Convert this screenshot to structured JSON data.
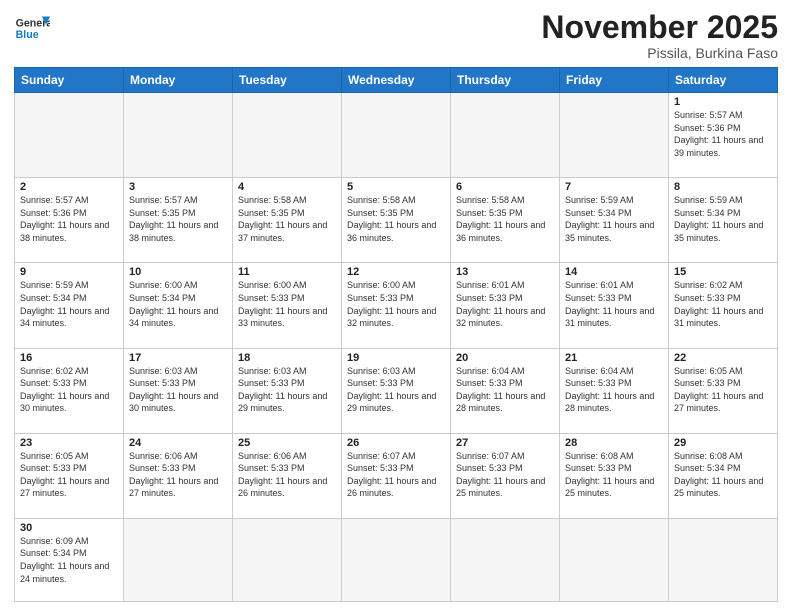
{
  "header": {
    "logo_general": "General",
    "logo_blue": "Blue",
    "month_title": "November 2025",
    "location": "Pissila, Burkina Faso"
  },
  "weekdays": [
    "Sunday",
    "Monday",
    "Tuesday",
    "Wednesday",
    "Thursday",
    "Friday",
    "Saturday"
  ],
  "days": [
    {
      "date": null,
      "number": "",
      "sunrise": "",
      "sunset": "",
      "daylight": ""
    },
    {
      "date": null,
      "number": "",
      "sunrise": "",
      "sunset": "",
      "daylight": ""
    },
    {
      "date": null,
      "number": "",
      "sunrise": "",
      "sunset": "",
      "daylight": ""
    },
    {
      "date": null,
      "number": "",
      "sunrise": "",
      "sunset": "",
      "daylight": ""
    },
    {
      "date": null,
      "number": "",
      "sunrise": "",
      "sunset": "",
      "daylight": ""
    },
    {
      "date": null,
      "number": "",
      "sunrise": "",
      "sunset": "",
      "daylight": ""
    },
    {
      "date": 1,
      "number": "1",
      "sunrise": "5:57 AM",
      "sunset": "5:36 PM",
      "daylight": "11 hours and 39 minutes."
    },
    {
      "date": 2,
      "number": "2",
      "sunrise": "5:57 AM",
      "sunset": "5:36 PM",
      "daylight": "11 hours and 38 minutes."
    },
    {
      "date": 3,
      "number": "3",
      "sunrise": "5:57 AM",
      "sunset": "5:35 PM",
      "daylight": "11 hours and 38 minutes."
    },
    {
      "date": 4,
      "number": "4",
      "sunrise": "5:58 AM",
      "sunset": "5:35 PM",
      "daylight": "11 hours and 37 minutes."
    },
    {
      "date": 5,
      "number": "5",
      "sunrise": "5:58 AM",
      "sunset": "5:35 PM",
      "daylight": "11 hours and 36 minutes."
    },
    {
      "date": 6,
      "number": "6",
      "sunrise": "5:58 AM",
      "sunset": "5:35 PM",
      "daylight": "11 hours and 36 minutes."
    },
    {
      "date": 7,
      "number": "7",
      "sunrise": "5:59 AM",
      "sunset": "5:34 PM",
      "daylight": "11 hours and 35 minutes."
    },
    {
      "date": 8,
      "number": "8",
      "sunrise": "5:59 AM",
      "sunset": "5:34 PM",
      "daylight": "11 hours and 35 minutes."
    },
    {
      "date": 9,
      "number": "9",
      "sunrise": "5:59 AM",
      "sunset": "5:34 PM",
      "daylight": "11 hours and 34 minutes."
    },
    {
      "date": 10,
      "number": "10",
      "sunrise": "6:00 AM",
      "sunset": "5:34 PM",
      "daylight": "11 hours and 34 minutes."
    },
    {
      "date": 11,
      "number": "11",
      "sunrise": "6:00 AM",
      "sunset": "5:33 PM",
      "daylight": "11 hours and 33 minutes."
    },
    {
      "date": 12,
      "number": "12",
      "sunrise": "6:00 AM",
      "sunset": "5:33 PM",
      "daylight": "11 hours and 32 minutes."
    },
    {
      "date": 13,
      "number": "13",
      "sunrise": "6:01 AM",
      "sunset": "5:33 PM",
      "daylight": "11 hours and 32 minutes."
    },
    {
      "date": 14,
      "number": "14",
      "sunrise": "6:01 AM",
      "sunset": "5:33 PM",
      "daylight": "11 hours and 31 minutes."
    },
    {
      "date": 15,
      "number": "15",
      "sunrise": "6:02 AM",
      "sunset": "5:33 PM",
      "daylight": "11 hours and 31 minutes."
    },
    {
      "date": 16,
      "number": "16",
      "sunrise": "6:02 AM",
      "sunset": "5:33 PM",
      "daylight": "11 hours and 30 minutes."
    },
    {
      "date": 17,
      "number": "17",
      "sunrise": "6:03 AM",
      "sunset": "5:33 PM",
      "daylight": "11 hours and 30 minutes."
    },
    {
      "date": 18,
      "number": "18",
      "sunrise": "6:03 AM",
      "sunset": "5:33 PM",
      "daylight": "11 hours and 29 minutes."
    },
    {
      "date": 19,
      "number": "19",
      "sunrise": "6:03 AM",
      "sunset": "5:33 PM",
      "daylight": "11 hours and 29 minutes."
    },
    {
      "date": 20,
      "number": "20",
      "sunrise": "6:04 AM",
      "sunset": "5:33 PM",
      "daylight": "11 hours and 28 minutes."
    },
    {
      "date": 21,
      "number": "21",
      "sunrise": "6:04 AM",
      "sunset": "5:33 PM",
      "daylight": "11 hours and 28 minutes."
    },
    {
      "date": 22,
      "number": "22",
      "sunrise": "6:05 AM",
      "sunset": "5:33 PM",
      "daylight": "11 hours and 27 minutes."
    },
    {
      "date": 23,
      "number": "23",
      "sunrise": "6:05 AM",
      "sunset": "5:33 PM",
      "daylight": "11 hours and 27 minutes."
    },
    {
      "date": 24,
      "number": "24",
      "sunrise": "6:06 AM",
      "sunset": "5:33 PM",
      "daylight": "11 hours and 27 minutes."
    },
    {
      "date": 25,
      "number": "25",
      "sunrise": "6:06 AM",
      "sunset": "5:33 PM",
      "daylight": "11 hours and 26 minutes."
    },
    {
      "date": 26,
      "number": "26",
      "sunrise": "6:07 AM",
      "sunset": "5:33 PM",
      "daylight": "11 hours and 26 minutes."
    },
    {
      "date": 27,
      "number": "27",
      "sunrise": "6:07 AM",
      "sunset": "5:33 PM",
      "daylight": "11 hours and 25 minutes."
    },
    {
      "date": 28,
      "number": "28",
      "sunrise": "6:08 AM",
      "sunset": "5:33 PM",
      "daylight": "11 hours and 25 minutes."
    },
    {
      "date": 29,
      "number": "29",
      "sunrise": "6:08 AM",
      "sunset": "5:34 PM",
      "daylight": "11 hours and 25 minutes."
    },
    {
      "date": 30,
      "number": "30",
      "sunrise": "6:09 AM",
      "sunset": "5:34 PM",
      "daylight": "11 hours and 24 minutes."
    }
  ],
  "labels": {
    "sunrise": "Sunrise:",
    "sunset": "Sunset:",
    "daylight": "Daylight:"
  }
}
